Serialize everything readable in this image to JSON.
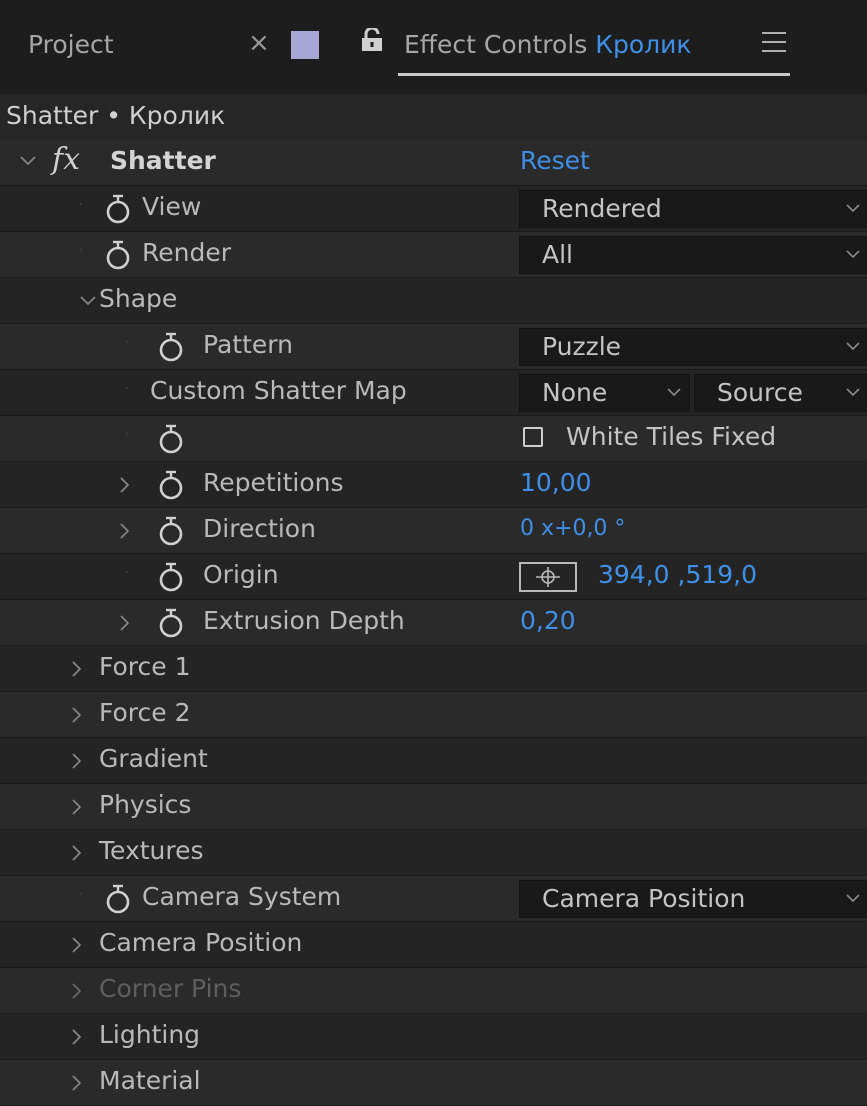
{
  "tabs": {
    "project": "Project",
    "close": "×",
    "effect_controls": "Effect Controls",
    "layer": "Кролик",
    "swatch_color": "#a7a6d4"
  },
  "breadcrumb": "Shatter • Кролик",
  "effect": {
    "fx": "fx",
    "name": "Shatter",
    "reset": "Reset"
  },
  "rows": {
    "view": {
      "label": "View",
      "value": "Rendered"
    },
    "render": {
      "label": "Render",
      "value": "All"
    },
    "shape": "Shape",
    "pattern": {
      "label": "Pattern",
      "value": "Puzzle"
    },
    "custom_map": {
      "label": "Custom Shatter Map",
      "value": "None",
      "source": "Source"
    },
    "white_tiles": {
      "label": "White Tiles Fixed",
      "checked": false
    },
    "repetitions": {
      "label": "Repetitions",
      "value": "10,00"
    },
    "direction": {
      "label": "Direction",
      "value": "0 x+0,0 °"
    },
    "origin": {
      "label": "Origin",
      "value": "394,0 ,519,0"
    },
    "extrusion": {
      "label": "Extrusion Depth",
      "value": "0,20"
    },
    "force1": "Force 1",
    "force2": "Force 2",
    "gradient": "Gradient",
    "physics": "Physics",
    "textures": "Textures",
    "camera_system": {
      "label": "Camera System",
      "value": "Camera Position"
    },
    "camera_position": "Camera Position",
    "corner_pins": "Corner Pins",
    "lighting": "Lighting",
    "material": "Material"
  },
  "colors": {
    "accent": "#3f8fe6",
    "panel": "#232323",
    "header": "#1d1d1d"
  }
}
